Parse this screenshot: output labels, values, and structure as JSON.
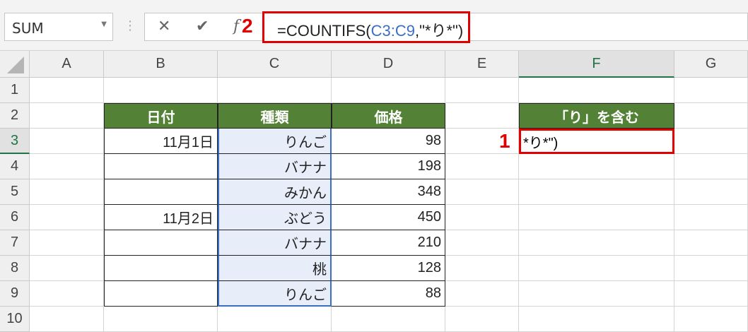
{
  "name_box": "SUM",
  "formula_bar": {
    "prefix": "=COUNTIFS(",
    "ref": "C3:C9",
    "suffix": ",\"*り*\")",
    "fx": "fx",
    "cancel": "✕",
    "enter": "✔"
  },
  "annotations": {
    "one": "1",
    "two": "2"
  },
  "columns": [
    "A",
    "B",
    "C",
    "D",
    "E",
    "F",
    "G"
  ],
  "rows": [
    "1",
    "2",
    "3",
    "4",
    "5",
    "6",
    "7",
    "8",
    "9",
    "10"
  ],
  "table": {
    "headers": [
      "日付",
      "種類",
      "価格"
    ],
    "rows": [
      [
        "11月1日",
        "りんご",
        "98"
      ],
      [
        "",
        "バナナ",
        "198"
      ],
      [
        "",
        "みかん",
        "348"
      ],
      [
        "11月2日",
        "ぶどう",
        "450"
      ],
      [
        "",
        "バナナ",
        "210"
      ],
      [
        "",
        "桃",
        "128"
      ],
      [
        "",
        "りんご",
        "88"
      ]
    ]
  },
  "f_header": "「り」を含む",
  "f3_value": "*り*\")",
  "colors": {
    "header_green": "#538135",
    "highlight_red": "#e00000",
    "selected_range": "#e7eef9"
  }
}
